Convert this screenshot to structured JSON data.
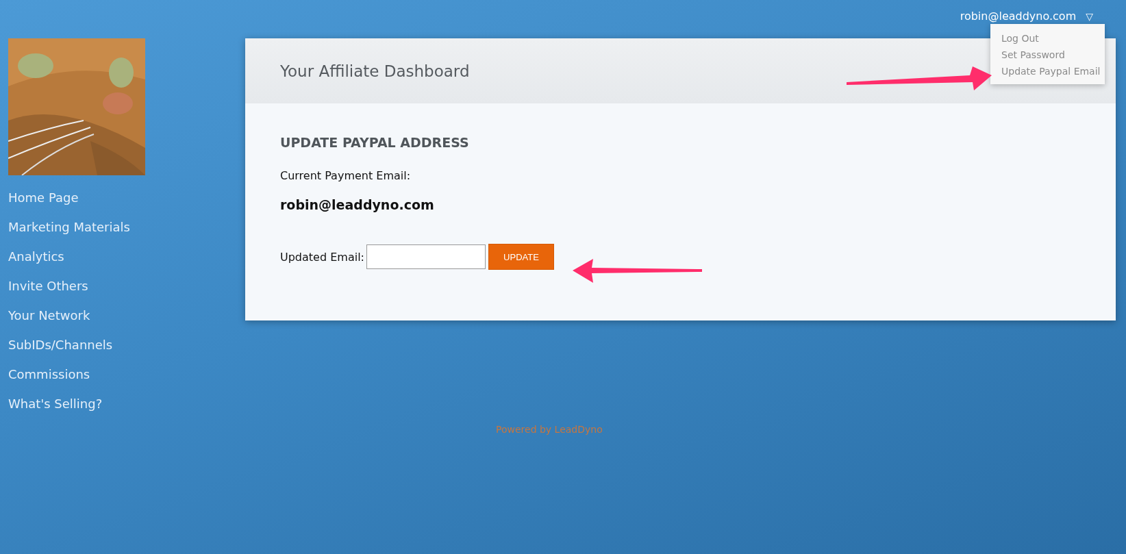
{
  "user_menu": {
    "label": "robin@leaddyno.com",
    "caret": "▽",
    "expanded": true,
    "items": [
      {
        "label": "Log Out"
      },
      {
        "label": "Set Password"
      },
      {
        "label": "Update Paypal Email"
      }
    ]
  },
  "sidebar": {
    "items": [
      {
        "label": "Home Page"
      },
      {
        "label": "Marketing Materials"
      },
      {
        "label": "Analytics"
      },
      {
        "label": "Invite Others"
      },
      {
        "label": "Your Network"
      },
      {
        "label": "SubIDs/Channels"
      },
      {
        "label": "Commissions"
      },
      {
        "label": "What's Selling?"
      }
    ]
  },
  "card": {
    "title": "Your Affiliate Dashboard",
    "heading": "UPDATE PAYPAL ADDRESS",
    "current_label": "Current Payment Email:",
    "current_value": "robin@leaddyno.com",
    "field_label": "Updated Email:",
    "button": "UPDATE"
  },
  "footer": "Powered by LeadDyno"
}
